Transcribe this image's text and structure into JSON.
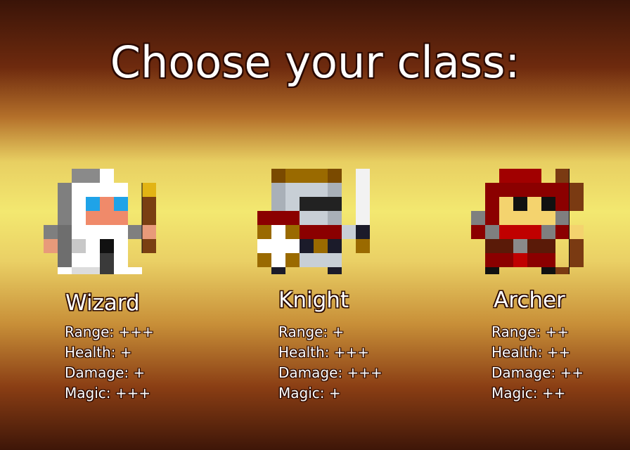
{
  "title": "Choose your class:",
  "classes": [
    {
      "name": "Wizard",
      "stats": [
        {
          "label": "Range:",
          "value": "+++"
        },
        {
          "label": "Health:",
          "value": "+"
        },
        {
          "label": "Damage:",
          "value": "+"
        },
        {
          "label": "Magic:",
          "value": "+++"
        }
      ]
    },
    {
      "name": "Knight",
      "stats": [
        {
          "label": "Range:",
          "value": "+"
        },
        {
          "label": "Health:",
          "value": "+++"
        },
        {
          "label": "Damage:",
          "value": "+++"
        },
        {
          "label": "Magic:",
          "value": "+"
        }
      ]
    },
    {
      "name": "Archer",
      "stats": [
        {
          "label": "Range:",
          "value": "++"
        },
        {
          "label": "Health:",
          "value": "++"
        },
        {
          "label": "Damage:",
          "value": "++"
        },
        {
          "label": "Magic:",
          "value": "++"
        }
      ]
    }
  ],
  "palette": {
    "wizard_robe": "#ffffff",
    "wizard_hood": "#7f7f7f",
    "wizard_eyes": "#1fa3e8",
    "wizard_skin": "#f08a6a",
    "wizard_staff_tip": "#e2b414",
    "knight_armor": "#c8cfd6",
    "knight_gold": "#9a6a00",
    "knight_red": "#8b0000",
    "archer_red": "#8b0000",
    "archer_skin": "#f4d36e",
    "archer_bow": "#7a3a12"
  }
}
